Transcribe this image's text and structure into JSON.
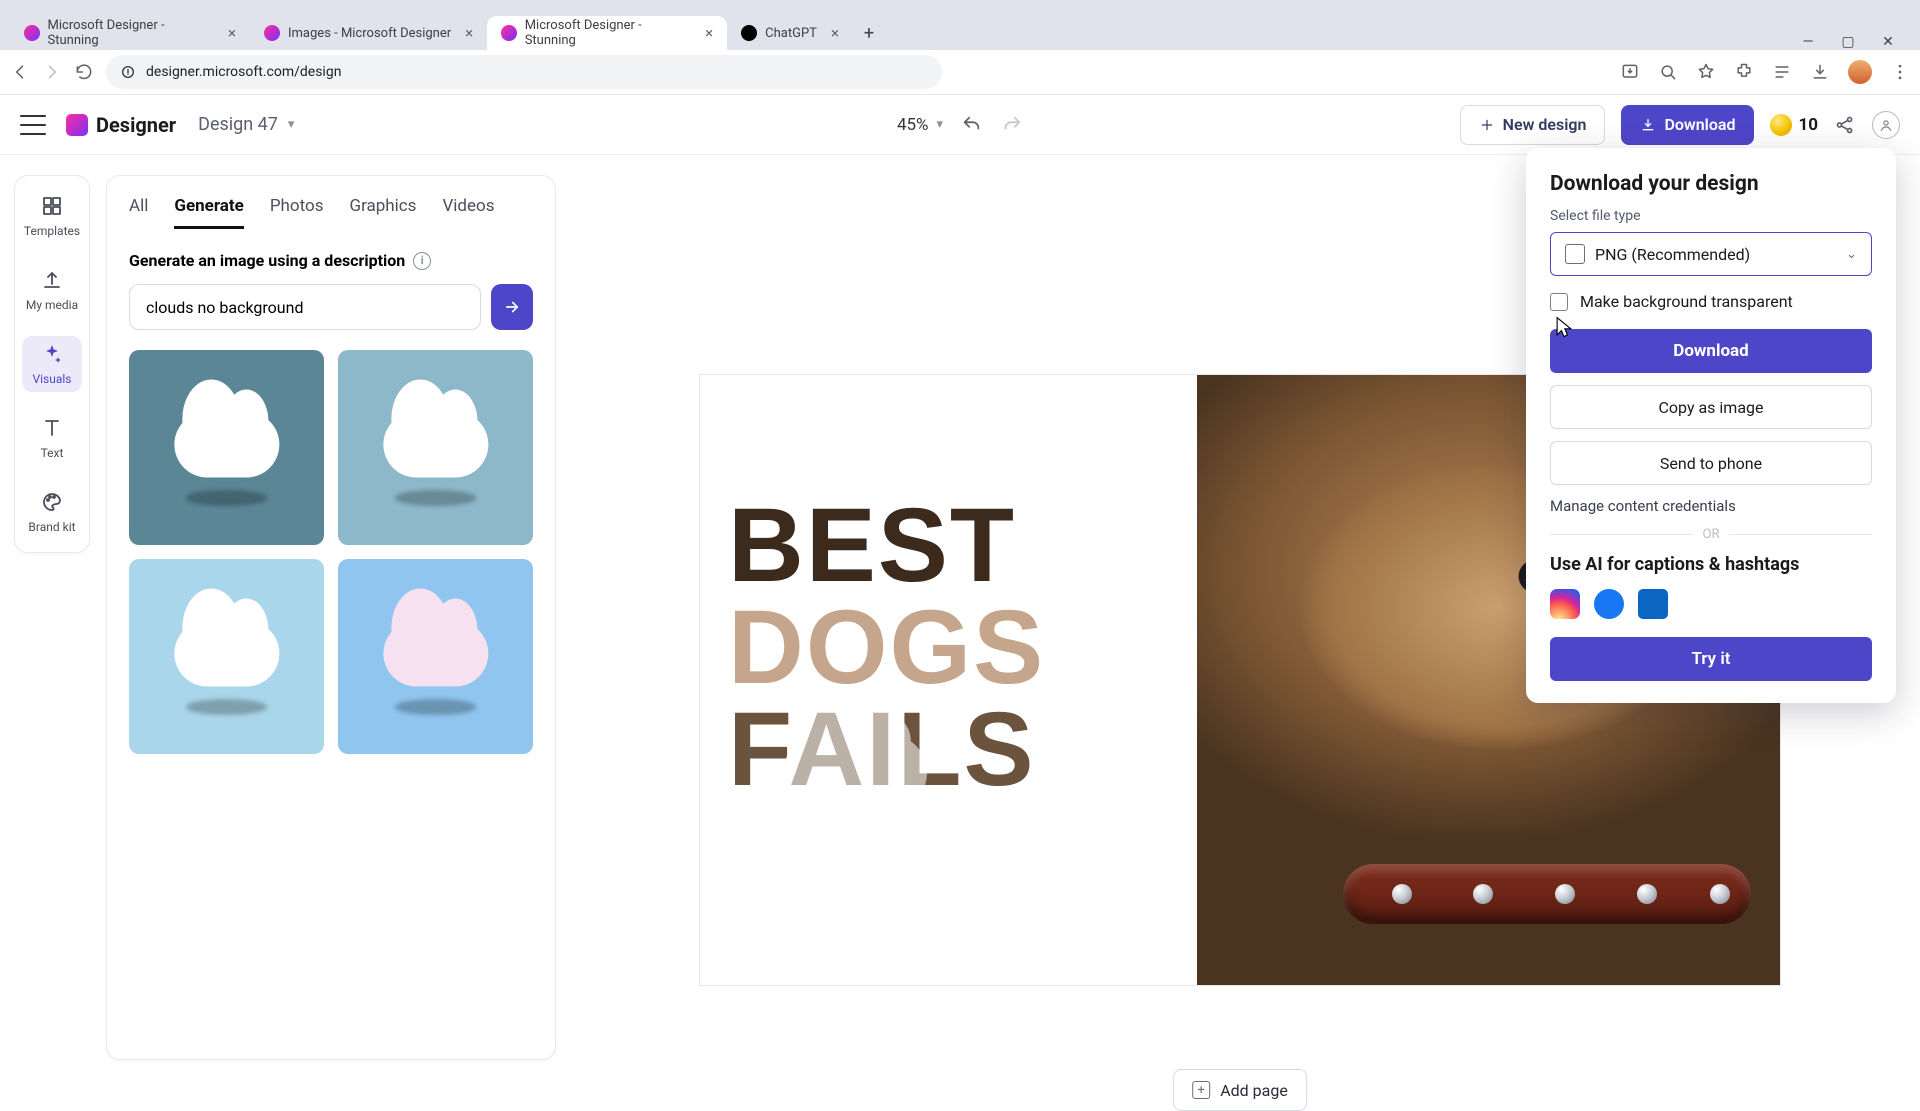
{
  "browser": {
    "tabs": [
      {
        "title": "Microsoft Designer - Stunning",
        "favicon": "#ff2e9a"
      },
      {
        "title": "Images - Microsoft Designer",
        "favicon": "#ff2e9a"
      },
      {
        "title": "Microsoft Designer - Stunning",
        "favicon": "#ff2e9a",
        "active": true
      },
      {
        "title": "ChatGPT",
        "favicon": "#000000"
      }
    ],
    "url": "designer.microsoft.com/design"
  },
  "header": {
    "brand": "Designer",
    "designLabel": "Design 47",
    "zoom": "45%",
    "newDesign": "New design",
    "download": "Download",
    "credits": "10"
  },
  "leftRail": {
    "items": [
      "Templates",
      "My media",
      "Visuals",
      "Text",
      "Brand kit"
    ],
    "activeIndex": 2
  },
  "sidePanel": {
    "tabs": [
      "All",
      "Generate",
      "Photos",
      "Graphics",
      "Videos"
    ],
    "activeIndex": 1,
    "generateLabel": "Generate an image using a description",
    "promptValue": "clouds no background"
  },
  "canvas": {
    "words": [
      "BEST",
      "DOGS",
      "FAILS"
    ],
    "addPage": "Add page"
  },
  "downloadPanel": {
    "title": "Download your design",
    "selectLabel": "Select file type",
    "fileType": "PNG (Recommended)",
    "transparent": "Make background transparent",
    "downloadBtn": "Download",
    "copyBtn": "Copy as image",
    "sendBtn": "Send to phone",
    "credentials": "Manage content credentials",
    "or": "OR",
    "aiTitle": "Use AI for captions & hashtags",
    "tryIt": "Try it"
  }
}
